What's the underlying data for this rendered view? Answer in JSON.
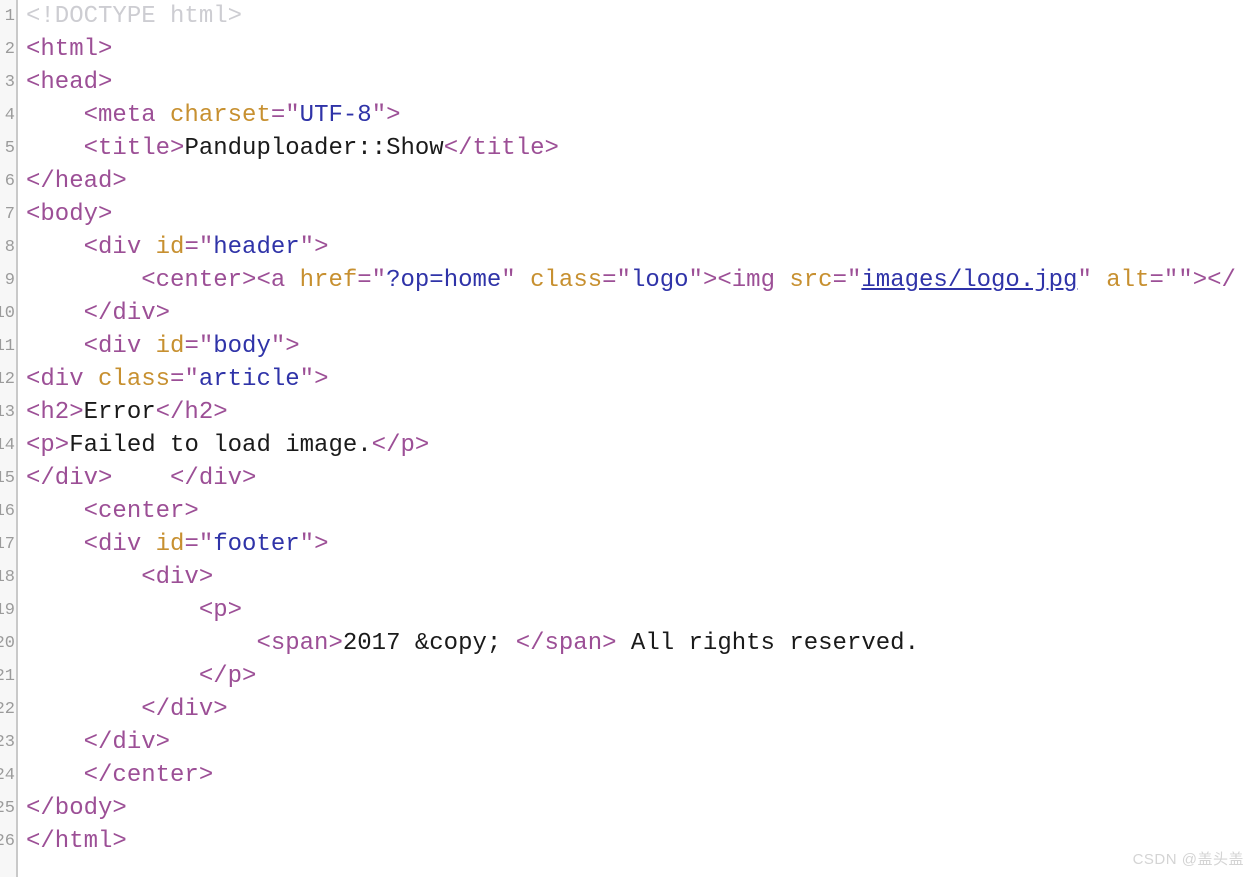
{
  "editor": {
    "language": "html",
    "background_color": "#ffffff",
    "gutter_background_color": "#f7f7f7",
    "gutter_border_color": "#c9c9c9",
    "line_number_color": "#9b9b9b",
    "first_line_number": 1,
    "last_line_number": 26,
    "line_numbers": [
      "1",
      "2",
      "3",
      "4",
      "5",
      "6",
      "7",
      "8",
      "9",
      "10",
      "11",
      "12",
      "13",
      "14",
      "15",
      "16",
      "17",
      "18",
      "19",
      "20",
      "21",
      "22",
      "23",
      "24",
      "25",
      "26"
    ],
    "colors": {
      "doctype": "#cdcdd2",
      "tag": "#9c4f96",
      "attribute_name": "#c79030",
      "attribute_value": "#2f33a8",
      "quote": "#9c4f96",
      "text": "#1a1a1a",
      "link": "#2f33a8"
    },
    "lines": [
      {
        "number": "1",
        "tokens": [
          {
            "cls": "t-doctype",
            "text": "<!DOCTYPE html>"
          }
        ]
      },
      {
        "number": "2",
        "tokens": [
          {
            "cls": "t-tag",
            "text": "<html>"
          }
        ]
      },
      {
        "number": "3",
        "tokens": [
          {
            "cls": "t-tag",
            "text": "<head>"
          }
        ]
      },
      {
        "number": "4",
        "tokens": [
          {
            "cls": "t-text",
            "text": "    "
          },
          {
            "cls": "t-tag",
            "text": "<meta "
          },
          {
            "cls": "t-attr",
            "text": "charset"
          },
          {
            "cls": "t-tag",
            "text": "="
          },
          {
            "cls": "t-quote",
            "text": "\""
          },
          {
            "cls": "t-val",
            "text": "UTF-8"
          },
          {
            "cls": "t-quote",
            "text": "\""
          },
          {
            "cls": "t-tag",
            "text": ">"
          }
        ]
      },
      {
        "number": "5",
        "tokens": [
          {
            "cls": "t-text",
            "text": "    "
          },
          {
            "cls": "t-tag",
            "text": "<title>"
          },
          {
            "cls": "t-text",
            "text": "Panduploader::Show"
          },
          {
            "cls": "t-tag",
            "text": "</title>"
          }
        ]
      },
      {
        "number": "6",
        "tokens": [
          {
            "cls": "t-tag",
            "text": "</head>"
          }
        ]
      },
      {
        "number": "7",
        "tokens": [
          {
            "cls": "t-tag",
            "text": "<body>"
          }
        ]
      },
      {
        "number": "8",
        "tokens": [
          {
            "cls": "t-text",
            "text": "    "
          },
          {
            "cls": "t-tag",
            "text": "<div "
          },
          {
            "cls": "t-attr",
            "text": "id"
          },
          {
            "cls": "t-tag",
            "text": "="
          },
          {
            "cls": "t-quote",
            "text": "\""
          },
          {
            "cls": "t-val",
            "text": "header"
          },
          {
            "cls": "t-quote",
            "text": "\""
          },
          {
            "cls": "t-tag",
            "text": ">"
          }
        ]
      },
      {
        "number": "9",
        "tokens": [
          {
            "cls": "t-text",
            "text": "        "
          },
          {
            "cls": "t-tag",
            "text": "<center><a "
          },
          {
            "cls": "t-attr",
            "text": "href"
          },
          {
            "cls": "t-tag",
            "text": "="
          },
          {
            "cls": "t-quote",
            "text": "\""
          },
          {
            "cls": "t-val",
            "text": "?op=home"
          },
          {
            "cls": "t-quote",
            "text": "\""
          },
          {
            "cls": "t-text",
            "text": " "
          },
          {
            "cls": "t-attr",
            "text": "class"
          },
          {
            "cls": "t-tag",
            "text": "="
          },
          {
            "cls": "t-quote",
            "text": "\""
          },
          {
            "cls": "t-val",
            "text": "logo"
          },
          {
            "cls": "t-quote",
            "text": "\""
          },
          {
            "cls": "t-tag",
            "text": "><img "
          },
          {
            "cls": "t-attr",
            "text": "src"
          },
          {
            "cls": "t-tag",
            "text": "="
          },
          {
            "cls": "t-quote",
            "text": "\""
          },
          {
            "cls": "t-link",
            "text": "images/logo.jpg"
          },
          {
            "cls": "t-quote",
            "text": "\""
          },
          {
            "cls": "t-text",
            "text": " "
          },
          {
            "cls": "t-attr",
            "text": "alt"
          },
          {
            "cls": "t-tag",
            "text": "="
          },
          {
            "cls": "t-quote",
            "text": "\"\""
          },
          {
            "cls": "t-tag",
            "text": "></"
          }
        ]
      },
      {
        "number": "10",
        "tokens": [
          {
            "cls": "t-text",
            "text": "    "
          },
          {
            "cls": "t-tag",
            "text": "</div>"
          }
        ]
      },
      {
        "number": "11",
        "tokens": [
          {
            "cls": "t-text",
            "text": "    "
          },
          {
            "cls": "t-tag",
            "text": "<div "
          },
          {
            "cls": "t-attr",
            "text": "id"
          },
          {
            "cls": "t-tag",
            "text": "="
          },
          {
            "cls": "t-quote",
            "text": "\""
          },
          {
            "cls": "t-val",
            "text": "body"
          },
          {
            "cls": "t-quote",
            "text": "\""
          },
          {
            "cls": "t-tag",
            "text": ">"
          }
        ]
      },
      {
        "number": "12",
        "tokens": [
          {
            "cls": "t-tag",
            "text": "<div "
          },
          {
            "cls": "t-attr",
            "text": "class"
          },
          {
            "cls": "t-tag",
            "text": "="
          },
          {
            "cls": "t-quote",
            "text": "\""
          },
          {
            "cls": "t-val",
            "text": "article"
          },
          {
            "cls": "t-quote",
            "text": "\""
          },
          {
            "cls": "t-tag",
            "text": ">"
          }
        ]
      },
      {
        "number": "13",
        "tokens": [
          {
            "cls": "t-tag",
            "text": "<h2>"
          },
          {
            "cls": "t-text",
            "text": "Error"
          },
          {
            "cls": "t-tag",
            "text": "</h2>"
          }
        ]
      },
      {
        "number": "14",
        "tokens": [
          {
            "cls": "t-tag",
            "text": "<p>"
          },
          {
            "cls": "t-text",
            "text": "Failed to load image."
          },
          {
            "cls": "t-tag",
            "text": "</p>"
          }
        ]
      },
      {
        "number": "15",
        "tokens": [
          {
            "cls": "t-tag",
            "text": "</div>"
          },
          {
            "cls": "t-text",
            "text": "    "
          },
          {
            "cls": "t-tag",
            "text": "</div>"
          }
        ]
      },
      {
        "number": "16",
        "tokens": [
          {
            "cls": "t-text",
            "text": "    "
          },
          {
            "cls": "t-tag",
            "text": "<center>"
          }
        ]
      },
      {
        "number": "17",
        "tokens": [
          {
            "cls": "t-text",
            "text": "    "
          },
          {
            "cls": "t-tag",
            "text": "<div "
          },
          {
            "cls": "t-attr",
            "text": "id"
          },
          {
            "cls": "t-tag",
            "text": "="
          },
          {
            "cls": "t-quote",
            "text": "\""
          },
          {
            "cls": "t-val",
            "text": "footer"
          },
          {
            "cls": "t-quote",
            "text": "\""
          },
          {
            "cls": "t-tag",
            "text": ">"
          }
        ]
      },
      {
        "number": "18",
        "tokens": [
          {
            "cls": "t-text",
            "text": "        "
          },
          {
            "cls": "t-tag",
            "text": "<div>"
          }
        ]
      },
      {
        "number": "19",
        "tokens": [
          {
            "cls": "t-text",
            "text": "            "
          },
          {
            "cls": "t-tag",
            "text": "<p>"
          }
        ]
      },
      {
        "number": "20",
        "tokens": [
          {
            "cls": "t-text",
            "text": "                "
          },
          {
            "cls": "t-tag",
            "text": "<span>"
          },
          {
            "cls": "t-text",
            "text": "2017 &copy; "
          },
          {
            "cls": "t-tag",
            "text": "</span>"
          },
          {
            "cls": "t-text",
            "text": " All rights reserved."
          }
        ]
      },
      {
        "number": "21",
        "tokens": [
          {
            "cls": "t-text",
            "text": "            "
          },
          {
            "cls": "t-tag",
            "text": "</p>"
          }
        ]
      },
      {
        "number": "22",
        "tokens": [
          {
            "cls": "t-text",
            "text": "        "
          },
          {
            "cls": "t-tag",
            "text": "</div>"
          }
        ]
      },
      {
        "number": "23",
        "tokens": [
          {
            "cls": "t-text",
            "text": "    "
          },
          {
            "cls": "t-tag",
            "text": "</div>"
          }
        ]
      },
      {
        "number": "24",
        "tokens": [
          {
            "cls": "t-text",
            "text": "    "
          },
          {
            "cls": "t-tag",
            "text": "</center>"
          }
        ]
      },
      {
        "number": "25",
        "tokens": [
          {
            "cls": "t-tag",
            "text": "</body>"
          }
        ]
      },
      {
        "number": "26",
        "tokens": [
          {
            "cls": "t-tag",
            "text": "</html>"
          }
        ]
      }
    ]
  },
  "watermark": {
    "text": "CSDN @盖头盖",
    "color": "#d4d4d4"
  }
}
